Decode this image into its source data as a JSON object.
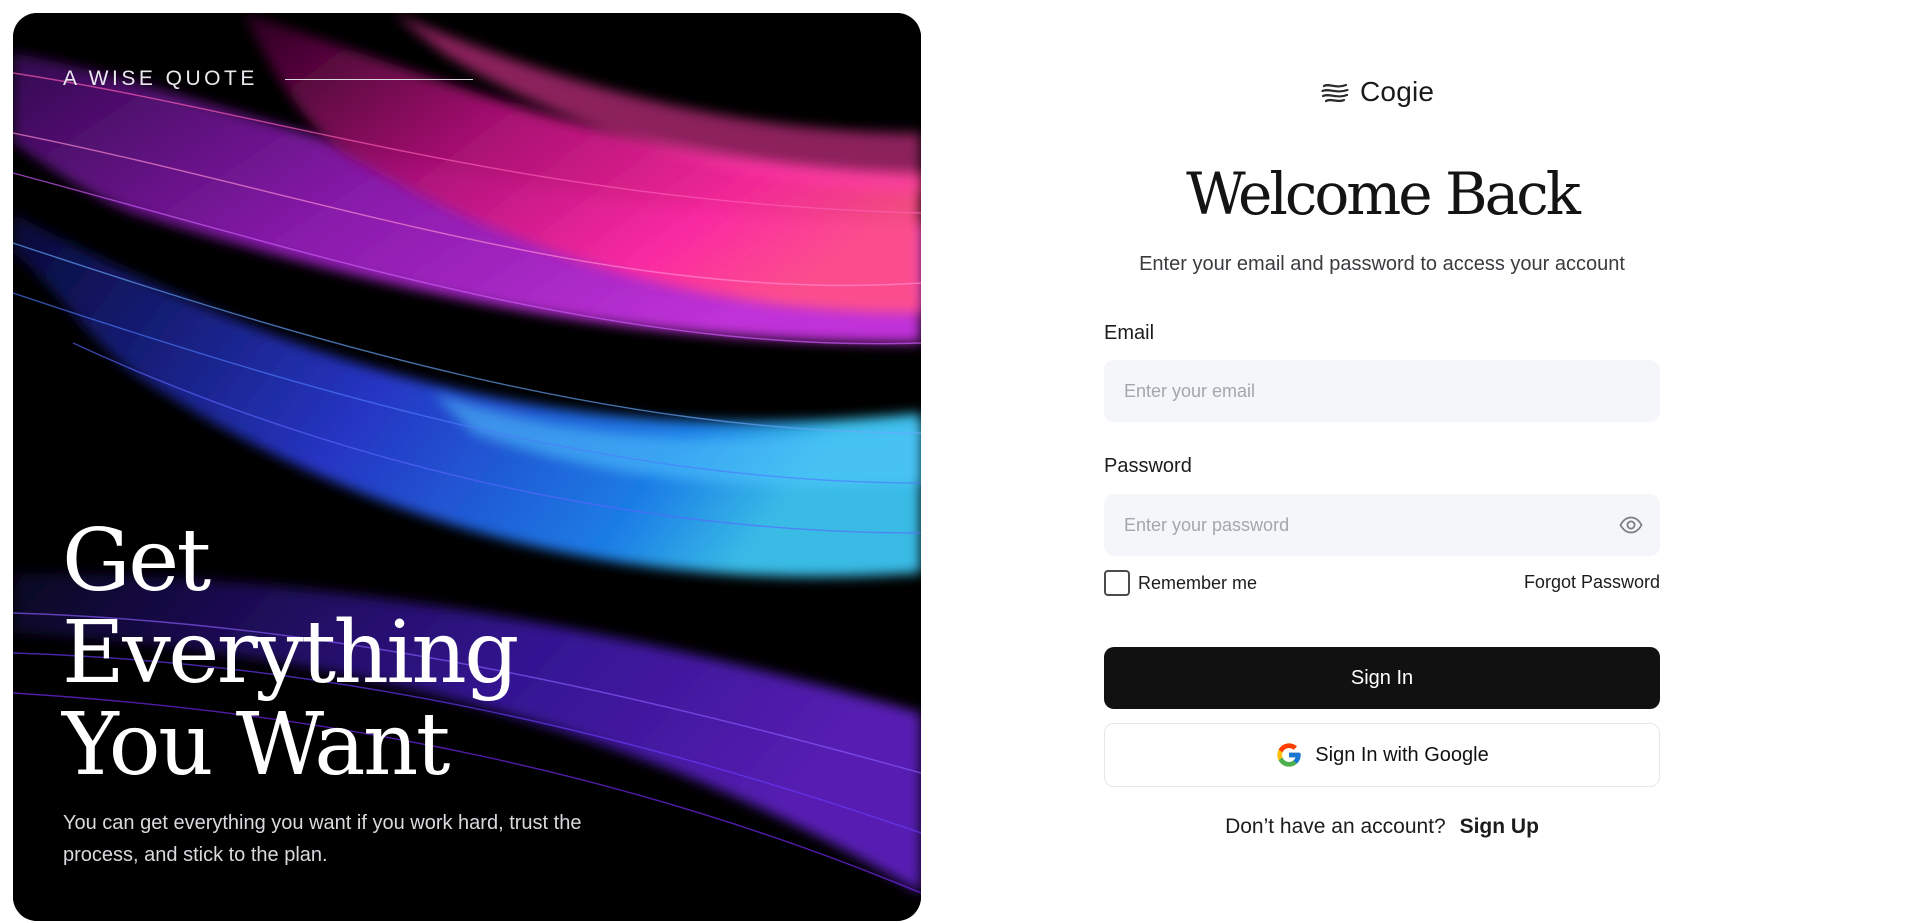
{
  "hero": {
    "eyebrow": "A WISE QUOTE",
    "title_lines": [
      "Get",
      "Everything",
      "You Want"
    ],
    "subtitle": "You can get everything you want if you work hard, trust the process, and stick to the plan."
  },
  "brand": {
    "name": "Cogie",
    "logo_icon": "wave-globe-icon"
  },
  "form": {
    "heading": "Welcome Back",
    "subheading": "Enter your email and password to access your account",
    "email": {
      "label": "Email",
      "placeholder": "Enter your email",
      "value": ""
    },
    "password": {
      "label": "Password",
      "placeholder": "Enter your password",
      "value": "",
      "toggle_icon": "eye-icon"
    },
    "remember_label": "Remember me",
    "remember_checked": false,
    "forgot_label": "Forgot Password",
    "sign_in_label": "Sign In",
    "google_label": "Sign In with Google",
    "google_icon": "google-icon",
    "signup_prompt": "Don’t have an account?",
    "signup_link": "Sign Up"
  },
  "colors": {
    "primary_button": "#111111",
    "input_background": "#f5f6f9",
    "hero_background": "#000000",
    "hero_accent_pink": "#ff1f9b",
    "hero_accent_blue": "#2f7dff",
    "hero_accent_purple": "#7a2cff"
  }
}
